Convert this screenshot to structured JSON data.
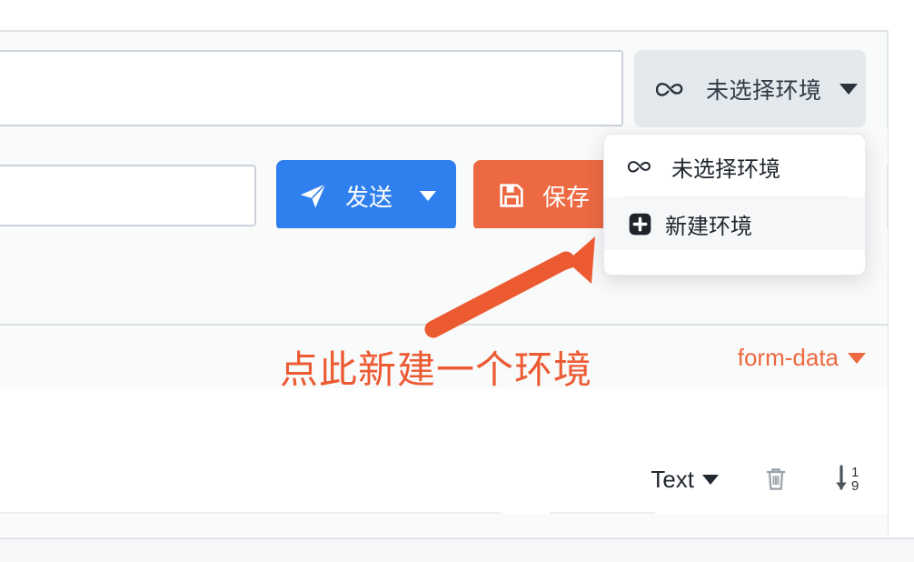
{
  "env_selector": {
    "label": "未选择环境",
    "icon": "infinity-cloud-icon",
    "caret": "chevron-down-icon",
    "bg_color": "#e4e9ed"
  },
  "dropdown": {
    "items": [
      {
        "label": "未选择环境",
        "icon": "infinity-cloud-icon",
        "active": false
      },
      {
        "label": "新建环境",
        "icon": "plus-square-icon",
        "active": true
      }
    ]
  },
  "actions": {
    "send": {
      "label": "发送",
      "icon": "paper-plane-icon",
      "caret": "chevron-down-icon",
      "color": "#2f80ee"
    },
    "save": {
      "label": "保存（",
      "icon": "floppy-save-icon",
      "color": "#ec6941"
    }
  },
  "body_toolbar": {
    "body_type": "form-data",
    "caret": "chevron-down-icon",
    "accent_color": "#ec6941"
  },
  "param_row": {
    "value_type": "Text",
    "caret": "chevron-down-icon",
    "delete_icon": "trash-icon",
    "sort_icon": "sort-numeric-down-icon",
    "sort_icon_digits": {
      "top": "1",
      "bottom": "9"
    }
  },
  "annotation": {
    "text": "点此新建一个环境",
    "color": "#ec5a32",
    "arrow": "arrow-up-right-icon"
  }
}
